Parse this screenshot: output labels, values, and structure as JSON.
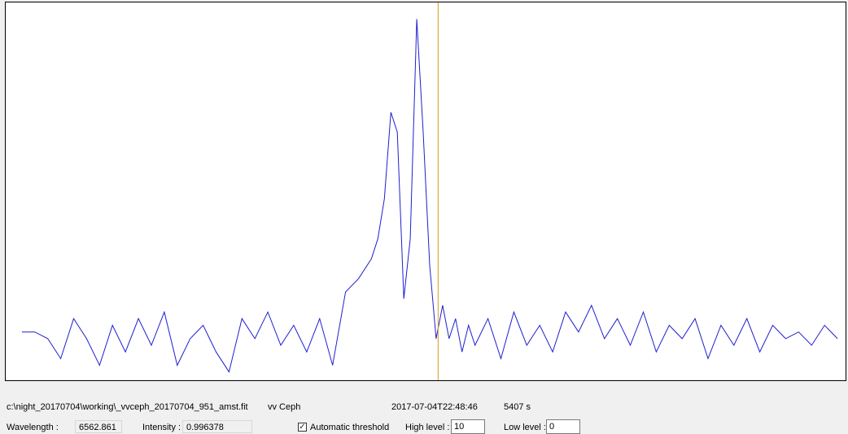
{
  "colors": {
    "spectrum_line": "#1f1fd0",
    "cursor_line": "#d4a017",
    "plot_background": "#ffffff",
    "window_background": "#f0f0f0"
  },
  "chart_data": {
    "type": "line",
    "title": "",
    "xlabel": "",
    "ylabel": "",
    "grid": false,
    "cursor_wavelength": 6562.861,
    "xlim": [
      6549.5,
      6575.5
    ],
    "ylim": [
      0.925,
      1.495
    ],
    "series": [
      {
        "x": [
          6550.0,
          6550.4,
          6550.8,
          6551.2,
          6551.6,
          6552.0,
          6552.4,
          6552.8,
          6553.2,
          6553.6,
          6554.0,
          6554.4,
          6554.8,
          6555.2,
          6555.6,
          6556.0,
          6556.4,
          6556.8,
          6557.2,
          6557.6,
          6558.0,
          6558.4,
          6558.8,
          6559.2,
          6559.6,
          6560.0,
          6560.4,
          6560.8,
          6561.0,
          6561.2,
          6561.4,
          6561.6,
          6561.8,
          6562.0,
          6562.2,
          6562.4,
          6562.6,
          6562.8,
          6563.0,
          6563.2,
          6563.4,
          6563.6,
          6563.8,
          6564.0,
          6564.4,
          6564.8,
          6565.2,
          6565.6,
          6566.0,
          6566.4,
          6566.8,
          6567.2,
          6567.6,
          6568.0,
          6568.4,
          6568.8,
          6569.2,
          6569.6,
          6570.0,
          6570.4,
          6570.8,
          6571.2,
          6571.6,
          6572.0,
          6572.4,
          6572.8,
          6573.2,
          6573.6,
          6574.0,
          6574.4,
          6574.8,
          6575.2
        ],
        "y": [
          1.0,
          1.0,
          0.99,
          0.96,
          1.02,
          0.99,
          0.95,
          1.01,
          0.97,
          1.02,
          0.98,
          1.03,
          0.95,
          0.99,
          1.01,
          0.97,
          0.94,
          1.02,
          0.99,
          1.03,
          0.98,
          1.01,
          0.97,
          1.02,
          0.95,
          1.06,
          1.08,
          1.11,
          1.14,
          1.2,
          1.33,
          1.3,
          1.05,
          1.14,
          1.47,
          1.3,
          1.1,
          0.99,
          1.04,
          0.99,
          1.02,
          0.97,
          1.01,
          0.98,
          1.02,
          0.96,
          1.03,
          0.98,
          1.01,
          0.97,
          1.03,
          1.0,
          1.04,
          0.99,
          1.02,
          0.98,
          1.03,
          0.97,
          1.01,
          0.99,
          1.02,
          0.96,
          1.01,
          0.98,
          1.02,
          0.97,
          1.01,
          0.99,
          1.0,
          0.98,
          1.01,
          0.99
        ]
      }
    ]
  },
  "info": {
    "file_path": "c:\\night_20170704\\working\\_vvceph_20170704_951_amst.fit",
    "object_name": "vv Ceph",
    "timestamp": "2017-07-04T22:48:46",
    "exposure": "5407 s"
  },
  "readouts": {
    "wavelength_label": "Wavelength :",
    "wavelength_value": "6562.861",
    "intensity_label": "Intensity :",
    "intensity_value": "0.996378"
  },
  "threshold": {
    "auto_label": "Automatic threshold",
    "auto_checked": true,
    "high_label": "High level :",
    "high_value": "10",
    "low_label": "Low level :",
    "low_value": "0"
  }
}
